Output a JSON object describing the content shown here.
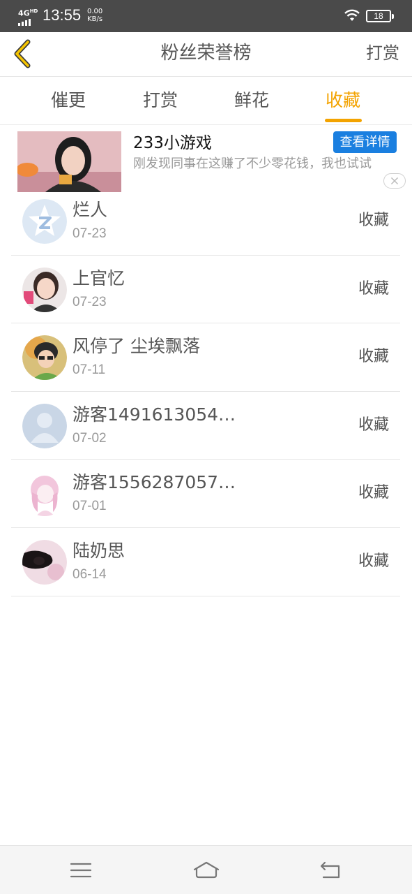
{
  "status_bar": {
    "network": "4G",
    "network_hd": "HD",
    "time": "13:55",
    "speed_value": "0.00",
    "speed_unit": "KB/s",
    "battery": "18"
  },
  "header": {
    "title": "粉丝荣誉榜",
    "action": "打赏",
    "back_icon": "chevron-left-icon",
    "accent_color": "#f3a300"
  },
  "tabs": [
    {
      "label": "催更",
      "active": false
    },
    {
      "label": "打赏",
      "active": false
    },
    {
      "label": "鲜花",
      "active": false
    },
    {
      "label": "收藏",
      "active": true
    }
  ],
  "ad": {
    "title": "233小游戏",
    "description": "刚发现同事在这赚了不少零花钱，我也试试",
    "button_label": "查看详情",
    "button_color": "#1a7fe0"
  },
  "fans": [
    {
      "name": "烂人",
      "date": "07-23",
      "action": "收藏",
      "avatar": "qq-star-avatar"
    },
    {
      "name": "上官忆",
      "date": "07-23",
      "action": "收藏",
      "avatar": "child-photo-avatar"
    },
    {
      "name": "风停了 尘埃飘落",
      "date": "07-11",
      "action": "收藏",
      "avatar": "boy-photo-avatar"
    },
    {
      "name": "游客1491613054…",
      "date": "07-02",
      "action": "收藏",
      "avatar": "default-person-avatar"
    },
    {
      "name": "游客1556287057…",
      "date": "07-01",
      "action": "收藏",
      "avatar": "anime-girl-avatar"
    },
    {
      "name": "陆奶思",
      "date": "06-14",
      "action": "收藏",
      "avatar": "dark-art-avatar"
    }
  ],
  "nav_bar": {
    "menu_icon": "menu-icon",
    "home_icon": "home-icon",
    "back_icon": "back-icon"
  }
}
